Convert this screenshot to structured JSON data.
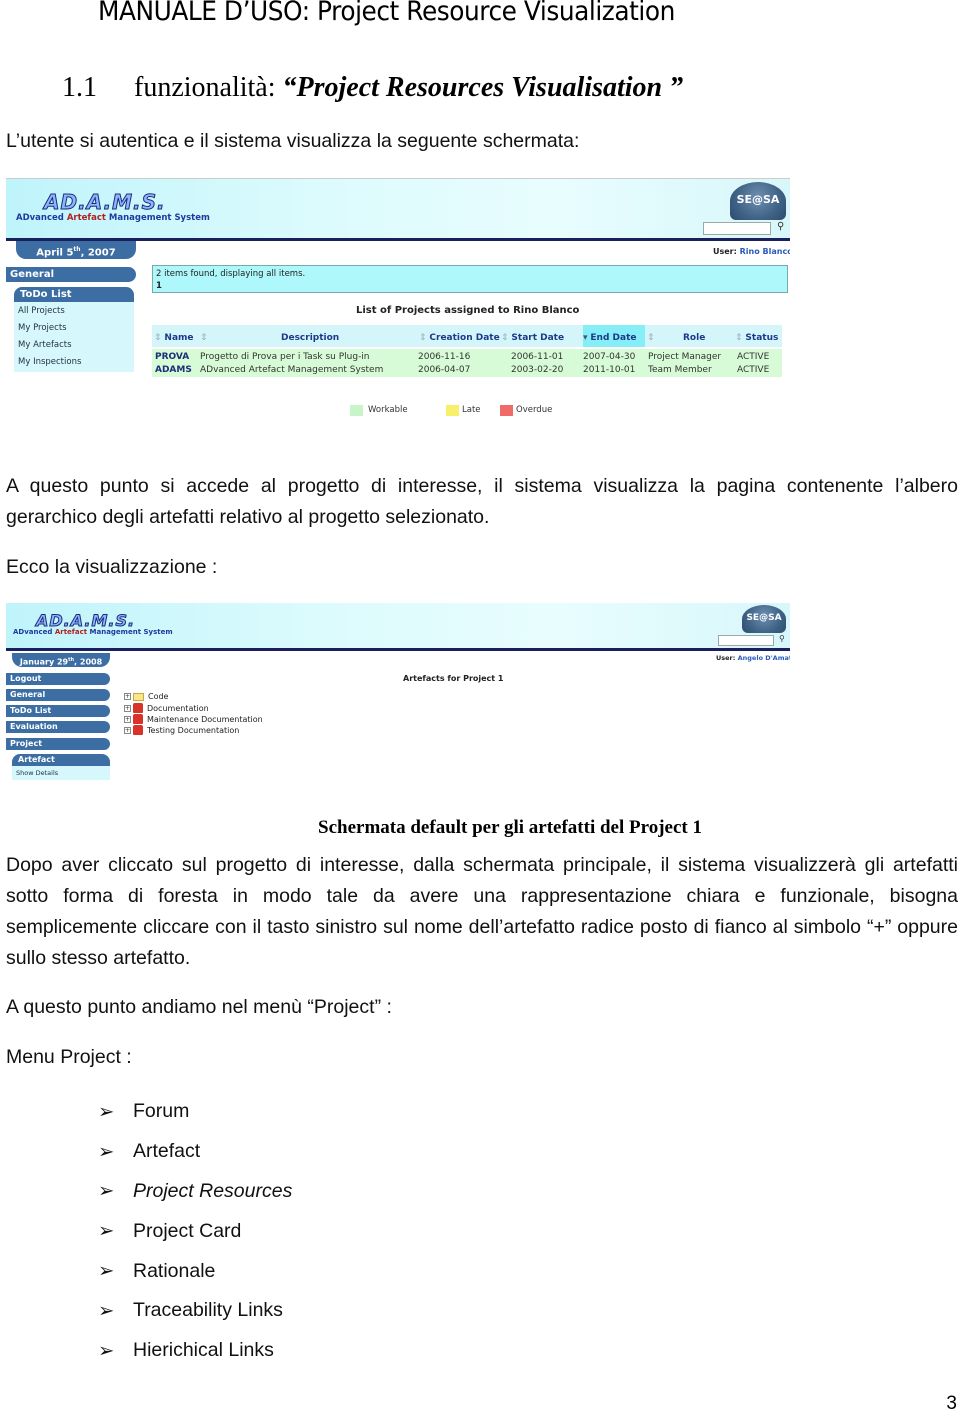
{
  "document": {
    "title": "MANUALE D’USO: Project Resource Visualization",
    "section_number": "1.1",
    "section_prefix": "funzionalità: ",
    "section_quoted": "“Project Resources Visualisation ”",
    "intro": "L’utente si autentica e il sistema visualizza la seguente schermata:",
    "para_access": "A questo punto si accede al progetto di interesse, il sistema visualizza la pagina contenente l’albero gerarchico degli artefatti relativo al progetto selezionato.",
    "para_ecco": "Ecco la visualizzazione :",
    "caption": "Schermata default per gli artefatti del Project 1",
    "para_dopo": "Dopo aver cliccato sul progetto di interesse, dalla schermata principale, il sistema visualizzerà gli artefatti sotto forma di foresta in modo tale da avere una rappresentazione chiara e funzionale,  bisogna semplicemente cliccare con il tasto sinistro sul nome dell’artefatto radice posto di fianco al simbolo “+” oppure sullo stesso artefatto.",
    "para_menu": "A questo punto andiamo nel menù “Project” :",
    "menu_heading": "Menu Project  :",
    "menu_items": [
      {
        "label": "Forum",
        "italic": false
      },
      {
        "label": "Artefact",
        "italic": false
      },
      {
        "label": "Project Resources",
        "italic": true
      },
      {
        "label": "Project Card",
        "italic": false
      },
      {
        "label": "Rationale",
        "italic": false
      },
      {
        "label": "Traceability Links",
        "italic": false
      },
      {
        "label": "Hierichical Links",
        "italic": false
      }
    ],
    "bullet_icon": "arrowhead-bullet-icon",
    "page_number": "3"
  },
  "screenshot1": {
    "logo": "AD.A.M.S.",
    "logo_sub_a": "ADvanced ",
    "logo_sub_b": "Artefact ",
    "logo_sub_c": "Management ",
    "logo_sub_d": "System",
    "seal_text": "SE@SA",
    "search_placeholder": "",
    "user_label": "User: ",
    "user_name": "Rino Blanco",
    "date_main": "April 5",
    "date_sup": "th",
    "date_year": ", 2007",
    "nav_general": "General",
    "sub_head": "ToDo List",
    "sub_items": [
      "All Projects",
      "My Projects",
      "My Artefacts",
      "My Inspections"
    ],
    "info_line1": "2 items found, displaying all items.",
    "info_line2": "1",
    "list_title": "List of Projects assigned to Rino Blanco",
    "columns": [
      "Name",
      "Description",
      "Creation Date",
      "Start Date",
      "End Date",
      "Role",
      "Status"
    ],
    "sorted_column": "End Date",
    "rows": [
      [
        "PROVA",
        "Progetto di Prova per i Task su Plug-in",
        "2006-11-16",
        "2006-11-01",
        "2007-04-30",
        "Project Manager",
        "ACTIVE"
      ],
      [
        "ADAMS",
        "ADvanced Artefact Management System",
        "2006-04-07",
        "2003-02-20",
        "2011-10-01",
        "Team Member",
        "ACTIVE"
      ]
    ],
    "legend": [
      {
        "label": "Workable",
        "color": "#c8f5c8"
      },
      {
        "label": "Late",
        "color": "#f7f06a"
      },
      {
        "label": "Overdue",
        "color": "#f06a6a"
      }
    ]
  },
  "screenshot2": {
    "logo": "AD.A.M.S.",
    "logo_sub_a": "ADvanced ",
    "logo_sub_b": "Artefact ",
    "logo_sub_c": "Management ",
    "logo_sub_d": "System",
    "seal_text": "SE@SA",
    "user_label": "User: ",
    "user_name": "Angelo D'Amato",
    "date_main": "January 29",
    "date_sup": "th",
    "date_year": ", 2008",
    "nav": [
      "Logout",
      "General",
      "ToDo List",
      "Evaluation",
      "Project"
    ],
    "sub_head": "Artefact",
    "sub_items": [
      "Show Details"
    ],
    "page_title": "Artefacts for Project 1",
    "tree": [
      {
        "label": "Code",
        "icon": "folder-icon"
      },
      {
        "label": "Documentation",
        "icon": "document-icon"
      },
      {
        "label": "Maintenance Documentation",
        "icon": "document-icon"
      },
      {
        "label": "Testing Documentation",
        "icon": "document-icon"
      }
    ]
  },
  "colors": {
    "nav_blue": "#3c6ea3",
    "header_cyan": "#bff4fb",
    "header_rule": "#1a1f5e",
    "row_green": "#d6fbd6",
    "info_cyan": "#aef8fb"
  }
}
